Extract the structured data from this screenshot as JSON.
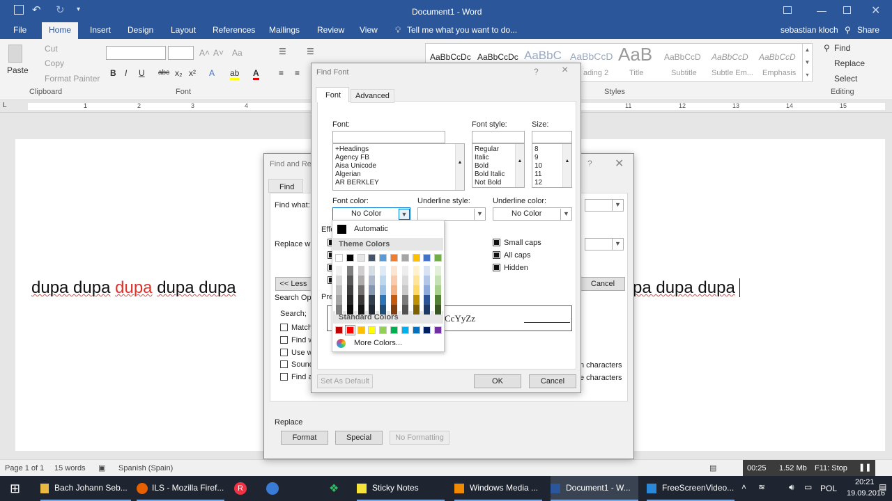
{
  "titlebar": {
    "doc_title": "Document1 - Word"
  },
  "tabs": {
    "file": "File",
    "home": "Home",
    "insert": "Insert",
    "design": "Design",
    "layout": "Layout",
    "references": "References",
    "mailings": "Mailings",
    "review": "Review",
    "view": "View",
    "tell_me": "Tell me what you want to do...",
    "user": "sebastian kloch",
    "share": "Share"
  },
  "ribbon": {
    "paste": "Paste",
    "cut": "Cut",
    "copy": "Copy",
    "format_painter": "Format Painter",
    "clipboard": "Clipboard",
    "font_group": "Font",
    "styles_group": "Styles",
    "editing_group": "Editing",
    "find": "Find",
    "replace": "Replace",
    "select": "Select",
    "styles": [
      "AaBbCcDc",
      "AaBbCcDc",
      "AaBbC",
      "AaBbCcD",
      "AaB",
      "AaBbCcD",
      "AaBbCcD",
      "AaBbCcD"
    ],
    "style_names": [
      "",
      "",
      "",
      "ading 2",
      "Title",
      "Subtitle",
      "Subtle Em...",
      "Emphasis"
    ]
  },
  "ruler_numbers": [
    "1",
    "1",
    "2",
    "3",
    "4",
    "11",
    "12",
    "13",
    "14",
    "15"
  ],
  "document": {
    "text_left": "dupa dupa",
    "text_red": "dupa",
    "text_mid": "dupa dupa",
    "text_right": "pa dupa dupa",
    "red_color": "#e0302a"
  },
  "status": {
    "page": "Page 1 of 1",
    "words": "15 words",
    "language": "Spanish (Spain)",
    "time_counter": "00:25",
    "size": "1.52 Mb",
    "stop": "F11: Stop"
  },
  "taskbar": {
    "items": [
      "Bach Johann Seb...",
      "ILS - Mozilla Firef...",
      "Sticky Notes",
      "Windows Media ...",
      "Document1 - W...",
      "FreeScreenVideo..."
    ],
    "lang": "POL",
    "time": "20:21",
    "date": "19.09.2016"
  },
  "find_replace": {
    "title": "Find and Re",
    "tab_find": "Find",
    "find_what": "Find what:",
    "replace_with": "Replace wi",
    "less_btn": "<< Less",
    "cancel": "Cancel",
    "search_options": "Search Opt",
    "search": "Search;",
    "match": "Match",
    "find_w": "Find w",
    "use_w": "Use w",
    "sound": "Sound",
    "find_a": "Find a",
    "n_characters": "n characters",
    "e_characters": "e characters",
    "replace_label": "Replace",
    "format_btn": "Format",
    "special_btn": "Special",
    "no_formatting": "No Formatting"
  },
  "find_font": {
    "title": "Find Font",
    "help": "?",
    "close": "×",
    "tab_font": "Font",
    "tab_advanced": "Advanced",
    "font_label": "Font:",
    "font_style_label": "Font style:",
    "size_label": "Size:",
    "fonts": [
      "+Headings",
      "Agency FB",
      "Aisa Unicode",
      "Algerian",
      "AR BERKLEY"
    ],
    "styles": [
      "Regular",
      "Italic",
      "Bold",
      "Bold Italic",
      "Not Bold"
    ],
    "sizes": [
      "8",
      "9",
      "10",
      "11",
      "12"
    ],
    "font_color_label": "Font color:",
    "font_color_value": "No Color",
    "underline_style_label": "Underline style:",
    "underline_color_label": "Underline color:",
    "underline_color_value": "No Color",
    "effects": "Effe",
    "small_caps": "Small caps",
    "all_caps": "All caps",
    "hidden": "Hidden",
    "preview_label": "Pre",
    "preview_text": "CcYyZz",
    "set_default": "Set As Default",
    "ok": "OK",
    "cancel": "Cancel"
  },
  "color_picker": {
    "automatic": "Automatic",
    "theme_colors": "Theme Colors",
    "standard_colors": "Standard Colors",
    "more_colors": "More Colors...",
    "theme_top": [
      "#ffffff",
      "#000000",
      "#e7e6e6",
      "#44546a",
      "#5b9bd5",
      "#ed7d31",
      "#a5a5a5",
      "#ffc000",
      "#4472c4",
      "#70ad47"
    ],
    "theme_shades": [
      [
        "#f2f2f2",
        "#7f7f7f",
        "#d0cece",
        "#d6dce4",
        "#deebf6",
        "#fbe5d5",
        "#ededed",
        "#fff2cc",
        "#d9e2f3",
        "#e2efd9"
      ],
      [
        "#d8d8d8",
        "#595959",
        "#aeabab",
        "#adb9ca",
        "#bdd7ee",
        "#f7cbac",
        "#dbdbdb",
        "#fee599",
        "#b4c6e7",
        "#c5e0b3"
      ],
      [
        "#bfbfbf",
        "#3f3f3f",
        "#757070",
        "#8496b0",
        "#9cc3e5",
        "#f4b183",
        "#c9c9c9",
        "#ffd965",
        "#8eaadb",
        "#a8d08d"
      ],
      [
        "#a5a5a5",
        "#262626",
        "#3a3838",
        "#323f4f",
        "#2e75b5",
        "#c55a11",
        "#7b7b7b",
        "#bf9000",
        "#2f5496",
        "#538135"
      ],
      [
        "#7f7f7f",
        "#0c0c0c",
        "#171616",
        "#222a35",
        "#1e4e79",
        "#833c0b",
        "#525252",
        "#7f6000",
        "#1f3864",
        "#375623"
      ]
    ],
    "standard": [
      "#c00000",
      "#ff0000",
      "#ffc000",
      "#ffff00",
      "#92d050",
      "#00b050",
      "#00b0f0",
      "#0070c0",
      "#002060",
      "#7030a0"
    ]
  }
}
